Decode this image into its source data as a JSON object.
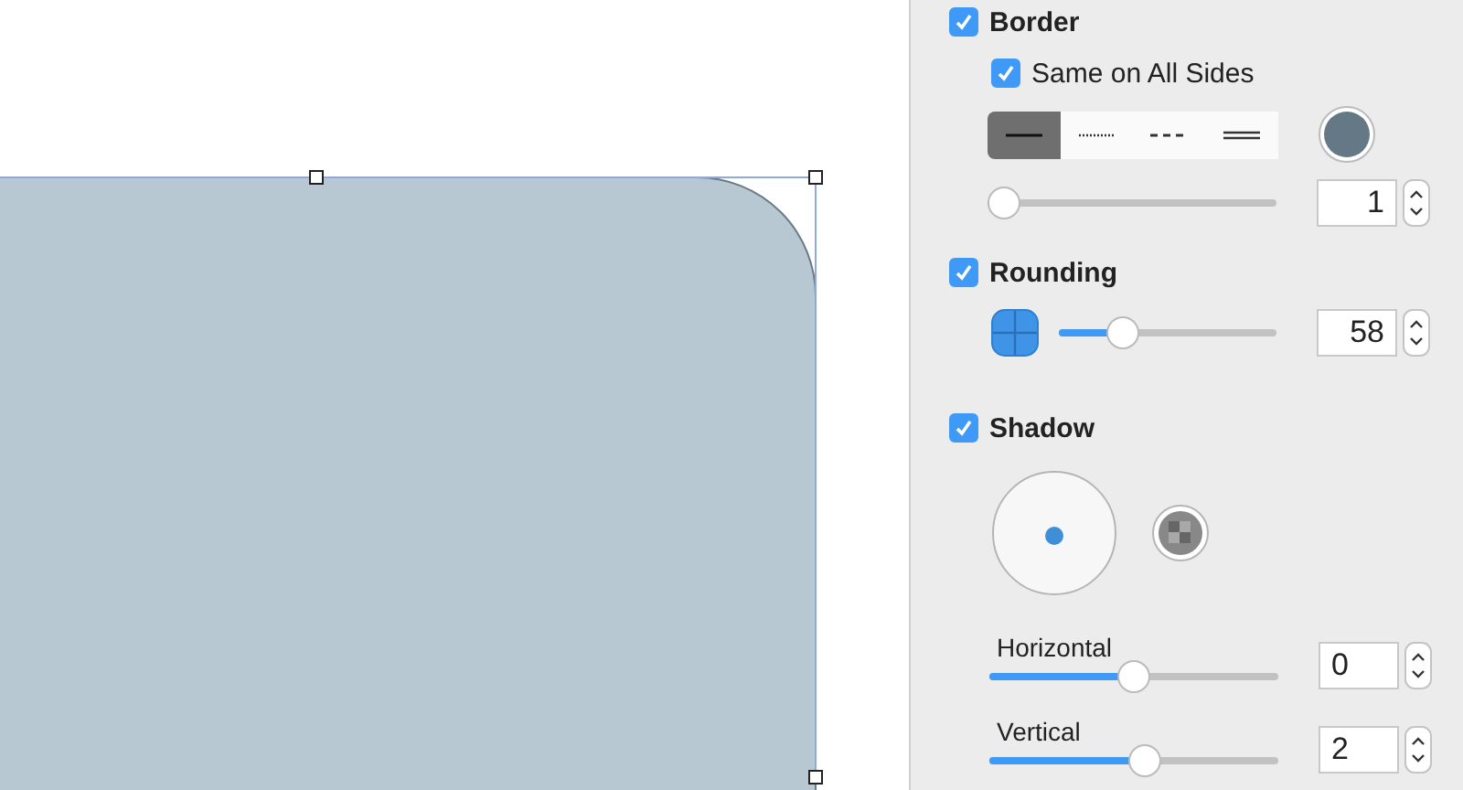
{
  "border": {
    "label": "Border",
    "checked": true,
    "same_sides": {
      "label": "Same on All Sides",
      "checked": true
    },
    "styles": [
      {
        "kind": "solid",
        "selected": true
      },
      {
        "kind": "dotted",
        "selected": false
      },
      {
        "kind": "dashed",
        "selected": false
      },
      {
        "kind": "double",
        "selected": false
      }
    ],
    "color": "#647985",
    "width": {
      "level": 0,
      "value": "1"
    }
  },
  "rounding": {
    "label": "Rounding",
    "checked": true,
    "level": 0.26,
    "value": "58"
  },
  "shadow": {
    "label": "Shadow",
    "checked": true,
    "sliders": [
      {
        "label": "Horizontal",
        "level": 0.5,
        "value": "0"
      },
      {
        "label": "Vertical",
        "level": 0.54,
        "value": "2"
      }
    ]
  }
}
